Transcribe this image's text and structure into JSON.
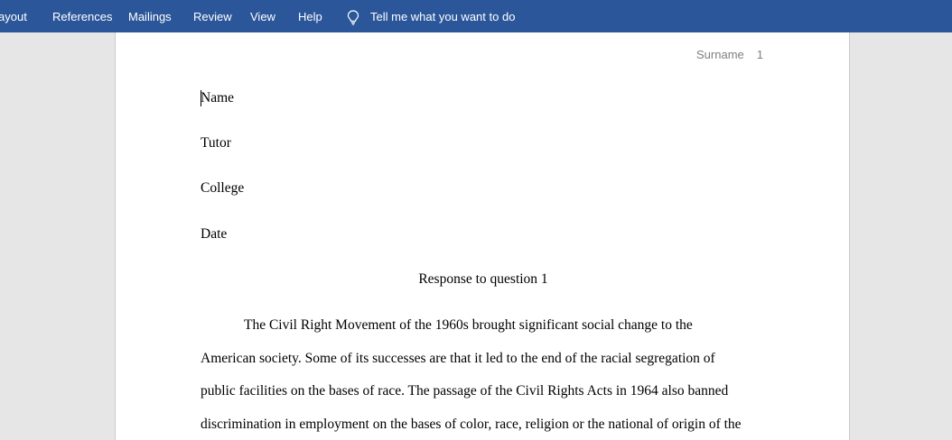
{
  "ribbon": {
    "tabs": [
      "ayout",
      "References",
      "Mailings",
      "Review",
      "View",
      "Help"
    ],
    "tell_me": "Tell me what you want to do",
    "tell_me_icon": "lightbulb-icon",
    "background": "#2b579a"
  },
  "header": {
    "surname": "Surname",
    "page_number": "1"
  },
  "document": {
    "heading_lines": [
      "Name",
      "Tutor",
      "College",
      "Date"
    ],
    "title": "Response to question 1",
    "paragraph_lines": [
      "The Civil Right Movement of the 1960s brought significant social change to the",
      "American society.  Some of its successes are that it led to the end of the racial segregation of",
      "public facilities on the bases of race. The passage of the Civil Rights Acts in 1964 also banned",
      "discrimination in employment on the bases of color, race, religion or the national of origin of the"
    ]
  }
}
